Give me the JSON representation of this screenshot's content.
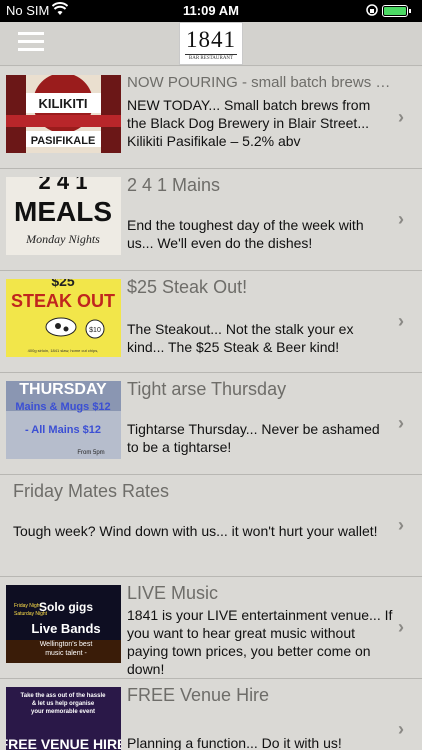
{
  "status_bar": {
    "carrier": "No SIM",
    "time": "11:09 AM"
  },
  "nav": {
    "logo_text": "1841",
    "logo_sub": "BAR RESTAURANT"
  },
  "items": [
    {
      "title": "NOW POURING - small batch brews fro...",
      "description": "NEW TODAY... Small batch brews from the Black Dog Brewery in Blair Street... Kilikiti Pasifikale – 5.2% abv",
      "thumb_text": [
        "KILIKITI",
        "PASIFIKALE"
      ]
    },
    {
      "title": "2 4 1 Mains",
      "description": "End the toughest day of the week with us... We'll even do the dishes!",
      "thumb_text": [
        "2 4 1",
        "MEALS",
        "Monday Nights"
      ]
    },
    {
      "title": "$25 Steak Out!",
      "description": "The Steakout... Not the stalk your ex kind... The $25 Steak & Beer kind!",
      "thumb_text": [
        "$25",
        "STEAK OUT",
        "$10",
        "400g sirloin, 1841 slaw, home cut chips,"
      ]
    },
    {
      "title": "Tight arse Thursday",
      "description": "Tightarse Thursday... Never be ashamed to be a tightarse!",
      "thumb_text": [
        "THURSDAY",
        "Mains & Mugs $12",
        "- All Mains $12",
        "From 5pm"
      ]
    },
    {
      "title": "Friday Mates Rates",
      "description": "Tough week? Wind down with us... it won't hurt your wallet!"
    },
    {
      "title": "LIVE Music",
      "description": "1841 is your LIVE entertainment venue... If you want to hear great music without paying town prices, you better come on down!",
      "thumb_text": [
        "Friday Night",
        "Saturday Night",
        "Solo gigs",
        "Live Bands",
        "Wellington's best",
        "music talent -"
      ]
    },
    {
      "title": "FREE Venue Hire",
      "description": "Planning a function... Do it with us!",
      "thumb_text": [
        "Take the ass out of the hassle",
        "& let us help organise",
        "your memorable event",
        "FREE VENUE HIRE"
      ]
    }
  ],
  "colors": {
    "background": "#dad9d5",
    "title_gray": "#6e6d69",
    "battery_green": "#4cd964",
    "steak_yellow": "#f3e84a"
  }
}
